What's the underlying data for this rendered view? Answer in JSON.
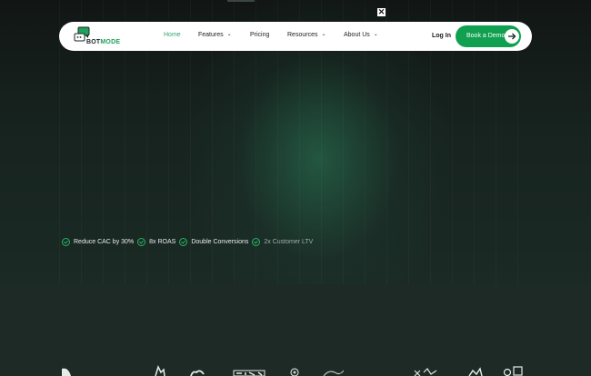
{
  "banner": {
    "close_glyph": "✕"
  },
  "nav": {
    "logo_text": "BOT",
    "logo_accent": "MODE",
    "items": [
      {
        "label": "Home",
        "active": true,
        "dropdown": false
      },
      {
        "label": "Features",
        "active": false,
        "dropdown": true
      },
      {
        "label": "Pricing",
        "active": false,
        "dropdown": false
      },
      {
        "label": "Resources",
        "active": false,
        "dropdown": true
      },
      {
        "label": "About Us",
        "active": false,
        "dropdown": true
      }
    ],
    "login_label": "Log In",
    "cta_label": "Book a Demo"
  },
  "hero": {
    "benefits": [
      "Reduce CAC by 30%",
      "8x ROAS",
      "Double Conversions",
      "2x Customer LTV"
    ]
  },
  "brand_logos": [
    "brand-logo-1-icon",
    "brand-logo-2-icon",
    "brand-logo-3-icon",
    "brand-logo-4-icon",
    "brand-logo-5-icon",
    "brand-logo-6-icon",
    "brand-logo-7-icon",
    "brand-logo-8-icon",
    "brand-logo-9-icon"
  ],
  "colors": {
    "brand_green": "#10a04f",
    "active_nav": "#35a46c",
    "background": "#1d2a26"
  }
}
